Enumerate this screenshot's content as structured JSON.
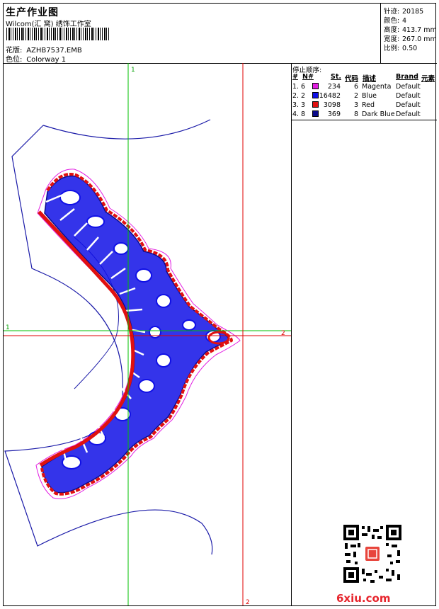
{
  "header": {
    "title": "生产作业图",
    "company": "Wilcom(汇 窝) 绣饰工作室",
    "design_label": "花版:",
    "design_value": "AZHB7537.EMB",
    "colorway_label": "色位:",
    "colorway_value": "Colorway 1"
  },
  "stats": {
    "stitches_label": "针迹:",
    "stitches_value": "20185",
    "colors_label": "颜色:",
    "colors_value": "4",
    "height_label": "高度:",
    "height_value": "413.7 mm",
    "width_label": "宽度:",
    "width_value": "267.0 mm",
    "scale_label": "比例:",
    "scale_value": "0.50"
  },
  "stop_sequence": {
    "title": "停止顺序:",
    "columns": [
      "#",
      "N#",
      "St.",
      "代码",
      "描述",
      "Brand",
      "元素"
    ],
    "rows": [
      {
        "idx": "1.",
        "n": "6",
        "st": "234",
        "code": "6",
        "desc": "Magenta",
        "brand": "Default",
        "color": "#e21ee2"
      },
      {
        "idx": "2.",
        "n": "2",
        "st": "16482",
        "code": "2",
        "desc": "Blue",
        "brand": "Default",
        "color": "#1010e6"
      },
      {
        "idx": "3.",
        "n": "3",
        "st": "3098",
        "code": "3",
        "desc": "Red",
        "brand": "Default",
        "color": "#e01010"
      },
      {
        "idx": "4.",
        "n": "8",
        "st": "369",
        "code": "8",
        "desc": "Dark Blue",
        "brand": "Default",
        "color": "#0a0a8a"
      }
    ]
  },
  "guides": {
    "v_green_label": "1",
    "h_green_label": "1",
    "h_red_label": "2",
    "v_red_label": "2"
  },
  "watermark": "6xiu.com",
  "qr_icon": "qr-code-icon",
  "colors": {
    "green_guide": "#00c000",
    "red_guide": "#e00000",
    "outline": "#1a1aa8",
    "fill_blue": "#1010e6",
    "satin_red": "#e01010",
    "magenta": "#e21ee2"
  }
}
